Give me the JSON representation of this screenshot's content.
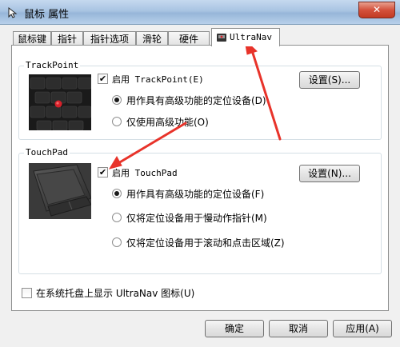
{
  "window": {
    "title": "鼠标 属性",
    "close_label": "✕"
  },
  "tabs": [
    {
      "label": "鼠标键"
    },
    {
      "label": "指针"
    },
    {
      "label": "指针选项"
    },
    {
      "label": "滑轮"
    },
    {
      "label": "硬件"
    },
    {
      "label": "UltraNav",
      "active": true
    }
  ],
  "trackpoint": {
    "group_title": "TrackPoint",
    "enable_label": "启用 TrackPoint(E)",
    "enabled": true,
    "settings_button": "设置(S)...",
    "option_advanced": "用作具有高级功能的定位设备(D)",
    "option_only_advanced": "仅使用高级功能(O)",
    "selected": "option_advanced"
  },
  "touchpad": {
    "group_title": "TouchPad",
    "enable_label": "启用 TouchPad",
    "enabled": true,
    "settings_button": "设置(N)...",
    "option_advanced": "用作具有高级功能的定位设备(F)",
    "option_slow_pointer": "仅将定位设备用于慢动作指针(M)",
    "option_scroll_click": "仅将定位设备用于滚动和点击区域(Z)",
    "selected": "option_advanced"
  },
  "tray": {
    "label": "在系统托盘上显示 UltraNav 图标(U)",
    "checked": false
  },
  "footer": {
    "ok": "确定",
    "cancel": "取消",
    "apply": "应用(A)"
  },
  "colors": {
    "annotation_arrow": "#e8332a",
    "trackpoint_red": "#d8202a"
  }
}
